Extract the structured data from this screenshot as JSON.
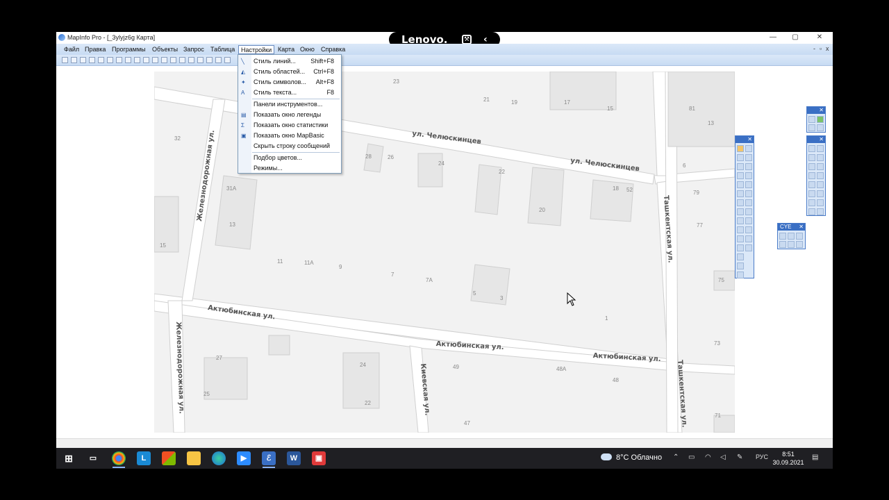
{
  "window": {
    "title": "MapInfo Pro - [_3ylyjz6g Карта]",
    "minimize": "—",
    "maximize": "▢",
    "close": "✕"
  },
  "lenovo_bar": {
    "brand": "Lenovo.",
    "tool_glyph": "⚒",
    "back_glyph": "‹"
  },
  "menubar": {
    "items": [
      "Файл",
      "Правка",
      "Программы",
      "Объекты",
      "Запрос",
      "Таблица",
      "Настройки",
      "Карта",
      "Окно",
      "Справка"
    ],
    "active": "Настройки",
    "mdi_controls": [
      "-",
      "▫",
      "x"
    ]
  },
  "dropdown": {
    "items": [
      {
        "label": "Стиль линий...",
        "shortcut": "Shift+F8",
        "icon": "line-style-icon"
      },
      {
        "label": "Стиль областей...",
        "shortcut": "Ctrl+F8",
        "icon": "region-style-icon"
      },
      {
        "label": "Стиль символов...",
        "shortcut": "Alt+F8",
        "icon": "symbol-style-icon"
      },
      {
        "label": "Стиль текста...",
        "shortcut": "F8",
        "icon": "text-style-icon"
      },
      {
        "label": "Панели инструментов...",
        "shortcut": "",
        "icon": ""
      },
      {
        "label": "Показать окно легенды",
        "shortcut": "",
        "icon": "legend-icon"
      },
      {
        "label": "Показать окно статистики",
        "shortcut": "",
        "icon": "statistics-icon"
      },
      {
        "label": "Показать окно MapBasic",
        "shortcut": "",
        "icon": "mapbasic-icon"
      },
      {
        "label": "Скрыть строку сообщений",
        "shortcut": "",
        "icon": ""
      },
      {
        "label": "Подбор цветов...",
        "shortcut": "",
        "icon": ""
      },
      {
        "label": "Режимы...",
        "shortcut": "",
        "icon": ""
      }
    ]
  },
  "map": {
    "streets": [
      "ул. Челюскинцев",
      "ул. Челюскинцев",
      "Железнодорожная ул.",
      "Ташкентская ул.",
      "Актюбинская ул.",
      "Актюбинская ул.",
      "Актюбинская ул.",
      "Железнодорожная ул.",
      "Киевская ул.",
      "Ташкентская ул."
    ],
    "house_numbers": [
      "23",
      "21",
      "19",
      "17",
      "15",
      "81",
      "13",
      "32",
      "28",
      "26",
      "24",
      "22",
      "20",
      "18",
      "52",
      "6",
      "79",
      "31А",
      "13",
      "77",
      "15",
      "11",
      "11А",
      "9",
      "7",
      "7А",
      "5",
      "3",
      "1",
      "75",
      "27",
      "24",
      "25",
      "22",
      "49",
      "48А",
      "48",
      "73",
      "47",
      "71"
    ]
  },
  "palettes": {
    "cosmetic_title": "CYE"
  },
  "taskbar": {
    "apps": [
      "start-icon",
      "task-view-icon",
      "chrome-icon",
      "lenovo-icon",
      "store-icon",
      "explorer-icon",
      "edge-icon",
      "zoom-icon",
      "mapinfo-icon",
      "word-icon",
      "app-icon"
    ],
    "weather": "8°C Облачно",
    "language": "РУС",
    "time": "8:51",
    "date": "30.09.2021"
  }
}
